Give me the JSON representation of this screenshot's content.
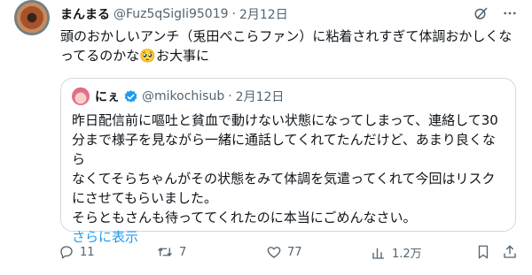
{
  "tweet": {
    "author_name": "まんまる",
    "author_handle": "@Fuz5qSigIi95019",
    "separator": "·",
    "date": "2月12日",
    "text_line1": "頭のおかしいアンチ（兎田ぺこらファン）に粘着されすぎて体調おかしくな",
    "text_line2_pre": "ってるのかな",
    "emoji": "🥺",
    "text_line2_post": "お大事に"
  },
  "quote": {
    "author_name": "にぇ",
    "author_handle": "@mikochisub",
    "separator": "·",
    "date": "2月12日",
    "line1": "昨日配信前に嘔吐と貧血で動けない状態になってしまって、連絡して30",
    "line2": "分まで様子を見ながら一緒に通話してくれてたんだけど、あまり良くなら",
    "line3": "なくてそらちゃんがその状態をみて体調を気遣ってくれて今回はリスク",
    "line4": "にさせてもらいました。",
    "line5": "そらともさんも待っててくれたのに本当にごめんなさい。",
    "show_more": "さらに表示"
  },
  "actions": {
    "replies": "11",
    "reposts": "7",
    "likes": "77",
    "views": "1.2万"
  },
  "icons": {
    "grok": "grok-icon",
    "more": "more-icon",
    "verified": "verified-badge-icon",
    "reply": "reply-icon",
    "repost": "repost-icon",
    "like": "heart-icon",
    "views": "views-icon",
    "bookmark": "bookmark-icon",
    "share": "share-icon"
  },
  "colors": {
    "text": "#0f1419",
    "muted": "#536471",
    "link": "#1d9bf0",
    "border": "#cfd9de"
  }
}
